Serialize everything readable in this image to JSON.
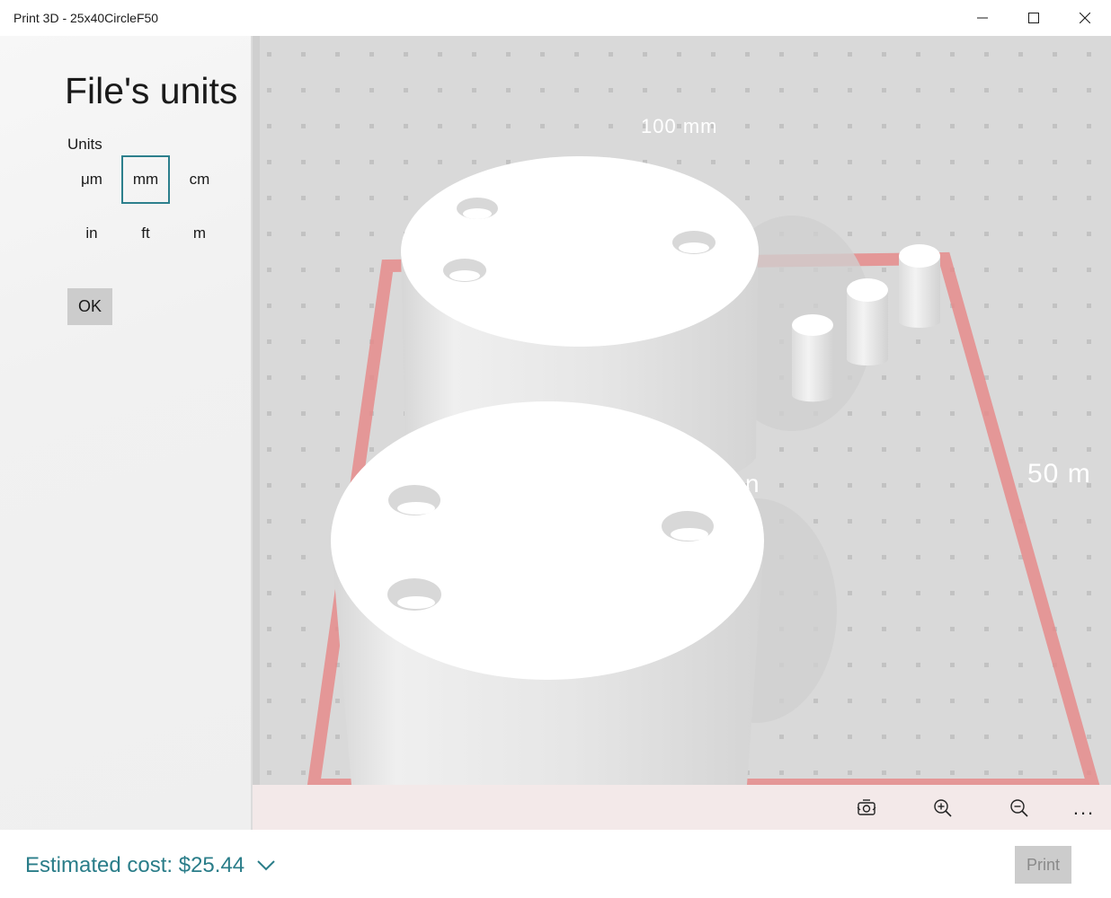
{
  "window": {
    "title": "Print 3D - 25x40CircleF50"
  },
  "panel": {
    "title": "File's units",
    "units_label": "Units",
    "units": [
      "μm",
      "mm",
      "cm",
      "in",
      "ft",
      "m"
    ],
    "selected_unit": "mm",
    "ok_label": "OK"
  },
  "viewport": {
    "axis_label_top": "100 mm",
    "axis_label_right": "50 m",
    "axis_label_mid": "n"
  },
  "toolbar": {
    "icons": [
      "rotate-view-icon",
      "zoom-in-icon",
      "zoom-out-icon",
      "more-icon"
    ],
    "more_label": "..."
  },
  "footer": {
    "cost_label": "Estimated cost: $25.44",
    "print_label": "Print"
  },
  "colors": {
    "accent": "#2a7d89",
    "plate_border": "#e58b8b",
    "viewport_bg": "#d9d9d9"
  }
}
